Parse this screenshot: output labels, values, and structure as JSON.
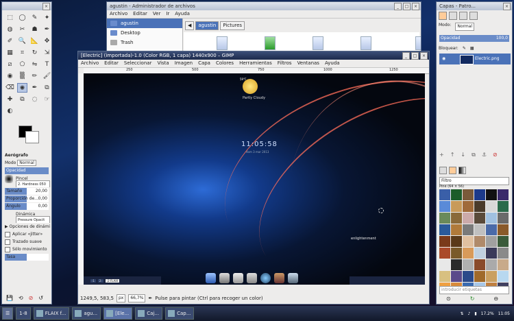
{
  "file_manager": {
    "title": "agustin - Administrador de archivos",
    "menu": [
      "Archivo",
      "Editar",
      "Ver",
      "Ir",
      "Ayuda"
    ],
    "sidebar": [
      "agustin",
      "Desktop",
      "Trash"
    ],
    "breadcrumbs": [
      "agustin",
      "Pictures"
    ]
  },
  "toolbox": {
    "tool_icons": [
      "rect-select",
      "ellipse-select",
      "free-select",
      "fuzzy-select",
      "color-select",
      "scissors",
      "foreground-select",
      "paths",
      "color-picker",
      "zoom",
      "measure",
      "move",
      "align",
      "crop",
      "rotate",
      "scale",
      "shear",
      "perspective",
      "flip",
      "text",
      "bucket-fill",
      "blend",
      "pencil",
      "paintbrush",
      "eraser",
      "airbrush",
      "ink",
      "clone",
      "heal",
      "perspective-clone",
      "blur",
      "smudge",
      "dodge-burn"
    ],
    "tool_glyphs": [
      "⬚",
      "◯",
      "✎",
      "✦",
      "◍",
      "✂",
      "☗",
      "✒",
      "✐",
      "🔍",
      "📐",
      "✥",
      "▦",
      "⌗",
      "↻",
      "⇲",
      "⧄",
      "⬠",
      "⇋",
      "T",
      "◉",
      "▒",
      "✏",
      "🖌",
      "⌫",
      "✺",
      "✒",
      "⧉",
      "✚",
      "⧉",
      "◌",
      "☞",
      "◐"
    ],
    "options_title": "Aerógrafo",
    "mode_label": "Modo",
    "mode_value": "Normal",
    "opacity_label": "Opacidad",
    "brush_label": "Pincel",
    "brush_value": "2. Hardness 050",
    "size_label": "Tamaño",
    "size_value": "20,00",
    "aspect_label": "Proporción de...",
    "aspect_value": "0,00",
    "angle_label": "Ángulo",
    "angle_value": "0,00",
    "dynamics_label": "Dinámica",
    "dynamics_value": "Pressure Opacit",
    "dynamics_options": "Opciones de dinámi",
    "jitter": "Aplicar «jitter»",
    "smooth": "Trazado suave",
    "only_move": "Sólo movimiento",
    "rate_label": "Tasa"
  },
  "gimp": {
    "title": "[Electric] (importada)-1.0 (Color RGB, 1 capa) 1440x900 – GIMP",
    "menu": [
      "Archivo",
      "Editar",
      "Seleccionar",
      "Vista",
      "Imagen",
      "Capa",
      "Colores",
      "Herramientas",
      "Filtros",
      "Ventanas",
      "Ayuda"
    ],
    "ruler_marks": [
      "250",
      "500",
      "750",
      "1000",
      "1250"
    ],
    "canvas": {
      "clock": "11:05:58",
      "clock_sub": "dom 3 mar 2013",
      "weather": "Partly Cloudy",
      "temp": "59°F",
      "logo": "enlightenment",
      "mini_taskbar": [
        "",
        ":1",
        "2:",
        ";2 FLAIX"
      ]
    },
    "status": {
      "coords": "1249,5, 583,5",
      "unit": "px",
      "zoom": "66,7%",
      "message": "Pulse para pintar (Ctrl para recoger un color)"
    }
  },
  "layers": {
    "title": "Capas - Patro...",
    "mode_label": "Modo:",
    "mode_value": "Normal",
    "opacity_label": "Opacidad",
    "opacity_value": "100,0",
    "lock_label": "Bloquear:",
    "layer_name": "Electric.png",
    "filter_placeholder": "Filtro",
    "pattern_name": "Pine (64 × 56)",
    "tags_placeholder": "introducir etiquetas",
    "pattern_colors": [
      "#3a5fa8",
      "#1c5c2a",
      "#7a5a3a",
      "#1c3a8a",
      "#111",
      "#3a2a6a",
      "#5a8ad8",
      "#c89a5a",
      "#a06a3a",
      "#4a3a2a",
      "#d8d8d8",
      "#2a6a4a",
      "#6a8a5a",
      "#8a6a3a",
      "#caa",
      "#5a4a3a",
      "#a0c0e0",
      "#6a6a6a",
      "#2a5a9a",
      "#b07a3a",
      "#7a7a7a",
      "#c0c0c0",
      "#4a6aa8",
      "#8a5a2a",
      "#7a3a1a",
      "#5a3a1a",
      "#e0c0a0",
      "#b08a6a",
      "#a0a0a0",
      "#3a5a3a",
      "#aa4a2a",
      "#7a5a2a",
      "#d89a5a",
      "#c0d0e0",
      "#3a3a5a",
      "#8a8a8a",
      "#e8e8e8",
      "#2a2a2a",
      "#b0b0b0",
      "#8a4a2a",
      "#aaa",
      "#c8aa8a",
      "#d8c080",
      "#5a4a8a",
      "#2a4a8a",
      "#a06a2a",
      "#caa060",
      "#b8d8f0",
      "#f0a040",
      "#d88a3a",
      "#3a6ab0",
      "#a8c8e8",
      "#c08040",
      "#404060"
    ]
  },
  "taskbar": {
    "desk": "1-8",
    "tasks": [
      "FLAIX f...",
      "agu...",
      "[Ele...",
      "Caj...",
      "Cap..."
    ],
    "clock": "11:05",
    "percent": "17.2%"
  }
}
